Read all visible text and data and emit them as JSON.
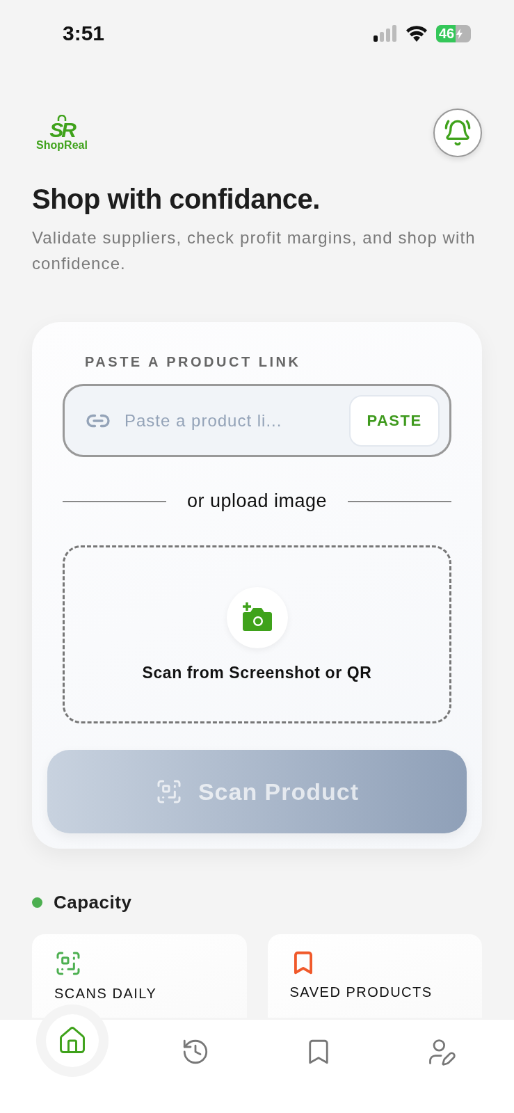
{
  "status_bar": {
    "time": "3:51",
    "battery": "46"
  },
  "header": {
    "logo": {
      "mark": "SR",
      "name": "ShopReal"
    }
  },
  "hero": {
    "title": "Shop with confidance.",
    "subtitle": "Validate suppliers, check profit margins, and shop with confidence."
  },
  "scan_card": {
    "link_label": "PASTE A PRODUCT LINK",
    "link_placeholder": "Paste a product li...",
    "paste_button": "PASTE",
    "divider": "or upload image",
    "upload_label": "Scan from Screenshot or QR",
    "scan_button": {
      "label": "Scan Product",
      "disabled": true
    }
  },
  "capacity": {
    "title": "Capacity",
    "stats": [
      {
        "kind": "scans",
        "label": "SCANS DAILY"
      },
      {
        "kind": "saved",
        "label": "SAVED PRODUCTS"
      }
    ]
  },
  "nav": [
    {
      "kind": "home",
      "selected": true
    },
    {
      "kind": "history",
      "selected": false
    },
    {
      "kind": "saved",
      "selected": false
    },
    {
      "kind": "profile",
      "selected": false
    }
  ]
}
